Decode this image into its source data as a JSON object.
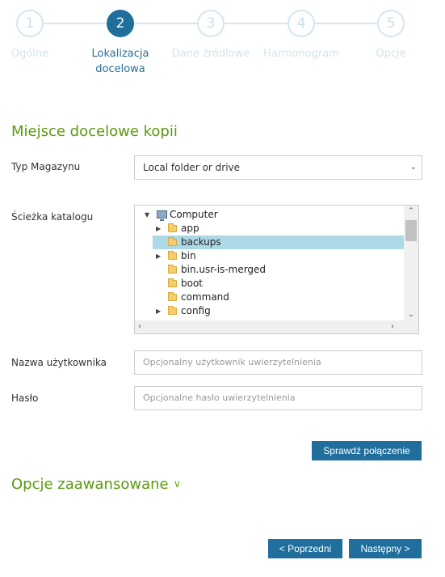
{
  "stepper": {
    "steps": [
      {
        "number": "1",
        "label": "Ogólne",
        "active": false
      },
      {
        "number": "2",
        "label": "Lokalizacja docelowa",
        "active": true
      },
      {
        "number": "3",
        "label": "Dane źródłowe",
        "active": false
      },
      {
        "number": "4",
        "label": "Harmonogram",
        "active": false
      },
      {
        "number": "5",
        "label": "Opcje",
        "active": false
      }
    ]
  },
  "section_title": "Miejsce docelowe kopii",
  "storage_type": {
    "label": "Typ Magazynu",
    "value": "Local folder or drive"
  },
  "path": {
    "label": "Ścieżka katalogu",
    "tree": {
      "root": "Computer",
      "items": [
        {
          "name": "app",
          "expandable": true,
          "selected": false
        },
        {
          "name": "backups",
          "expandable": false,
          "selected": true
        },
        {
          "name": "bin",
          "expandable": true,
          "selected": false
        },
        {
          "name": "bin.usr-is-merged",
          "expandable": false,
          "selected": false
        },
        {
          "name": "boot",
          "expandable": false,
          "selected": false
        },
        {
          "name": "command",
          "expandable": false,
          "selected": false
        },
        {
          "name": "config",
          "expandable": true,
          "selected": false
        }
      ]
    }
  },
  "username": {
    "label": "Nazwa użytkownika",
    "placeholder": "Opcjonalny użytkownik uwierzytelnienia"
  },
  "password": {
    "label": "Hasło",
    "placeholder": "Opcjonalne hasło uwierzytelnienia"
  },
  "buttons": {
    "test_connection": "Sprawdź połączenie",
    "previous": "< Poprzedni",
    "next": "Następny >"
  },
  "advanced_options": "Opcje zaawansowane",
  "colors": {
    "primary": "#1f6e9c",
    "section_green": "#5a9a0e",
    "selection": "#add8e6"
  }
}
